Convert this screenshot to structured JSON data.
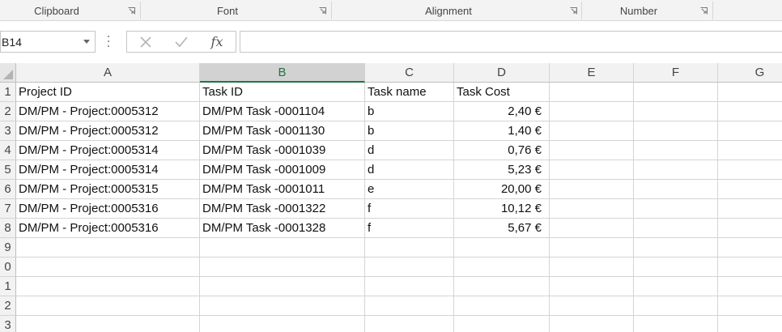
{
  "ribbon": {
    "groups": [
      {
        "label": "Clipboard"
      },
      {
        "label": "Font"
      },
      {
        "label": "Alignment"
      },
      {
        "label": "Number"
      }
    ]
  },
  "formula_bar": {
    "name_box": "B14",
    "cancel_icon": "cancel-x-icon",
    "enter_icon": "checkmark-icon",
    "function_label": "fx",
    "formula_value": ""
  },
  "columns": [
    "A",
    "B",
    "C",
    "D",
    "E",
    "F",
    "G"
  ],
  "selected_column": "B",
  "rows": [
    "1",
    "2",
    "3",
    "4",
    "5",
    "6",
    "7",
    "8",
    "9",
    "0",
    "1",
    "2",
    "3"
  ],
  "header_row": [
    "Project ID",
    "Task ID",
    "Task name",
    "Task Cost"
  ],
  "data_rows": [
    [
      "DM/PM - Project:0005312",
      "DM/PM Task -0001104",
      "b",
      "2,40 €"
    ],
    [
      "DM/PM - Project:0005312",
      "DM/PM Task -0001130",
      "b",
      "1,40 €"
    ],
    [
      "DM/PM - Project:0005314",
      "DM/PM Task -0001039",
      "d",
      "0,76 €"
    ],
    [
      "DM/PM - Project:0005314",
      "DM/PM Task -0001009",
      "d",
      "5,23 €"
    ],
    [
      "DM/PM - Project:0005315",
      "DM/PM Task -0001011",
      "e",
      "20,00 €"
    ],
    [
      "DM/PM - Project:0005316",
      "DM/PM Task -0001322",
      "f",
      "10,12 €"
    ],
    [
      "DM/PM - Project:0005316",
      "DM/PM Task -0001328",
      "f",
      "5,67 €"
    ]
  ],
  "colors": {
    "accent": "#217346",
    "gridline": "#d4d4d4",
    "header_bg": "#f2f2f2"
  }
}
